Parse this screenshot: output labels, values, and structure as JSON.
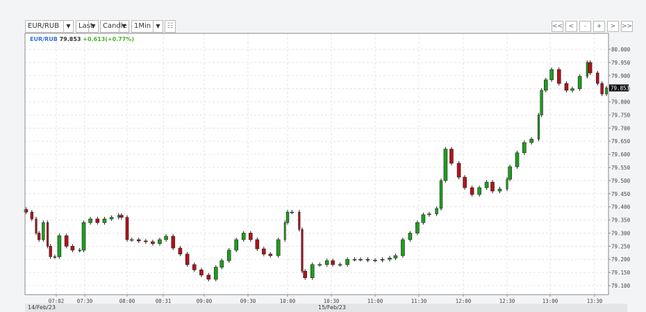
{
  "toolbar": {
    "symbol": "EUR/RUB",
    "price_type": "Last",
    "chart_type": "Candle",
    "interval": "1Min",
    "dropdown_icon": "triangle-down",
    "indicator_icon": "bar-chart-icon"
  },
  "nav": [
    "<<",
    "<",
    "-",
    "+",
    ">",
    ">>"
  ],
  "legend": {
    "symbol": "EUR/RUB",
    "price": "79.853",
    "change": "+0.613(+0.77%)",
    "symbol_color": "#3a6fd8",
    "change_color": "#4caf2a"
  },
  "dates": [
    "14/Feb/23",
    "15/Feb/23"
  ],
  "colors": {
    "up": "#1e9e1e",
    "down": "#b3121a"
  },
  "chart_data": {
    "type": "candlestick",
    "ylim": [
      79.08,
      80.06
    ],
    "y_ticks": [
      "80.000",
      "79.950",
      "79.900",
      "79.850",
      "79.800",
      "79.750",
      "79.700",
      "79.650",
      "79.600",
      "79.550",
      "79.500",
      "79.450",
      "79.400",
      "79.350",
      "79.300",
      "79.250",
      "79.200",
      "79.150",
      "79.100"
    ],
    "x_ticks": [
      "07:02",
      "07:30",
      "08:00",
      "08:31",
      "09:00",
      "09:30",
      "10:00",
      "10:30",
      "11:00",
      "11:30",
      "12:00",
      "12:30",
      "13:00",
      "13:30"
    ],
    "last_price": "79.853",
    "grid": true,
    "closes": [
      [
        "06:41",
        79.38
      ],
      [
        "06:45",
        79.354
      ],
      [
        "06:48",
        79.3
      ],
      [
        "06:50",
        79.275
      ],
      [
        "06:53",
        79.34
      ],
      [
        "06:56",
        79.25
      ],
      [
        "06:58",
        79.21
      ],
      [
        "07:01",
        79.21
      ],
      [
        "07:05",
        79.29
      ],
      [
        "07:12",
        79.25
      ],
      [
        "07:18",
        79.235
      ],
      [
        "07:25",
        79.235
      ],
      [
        "07:29",
        79.34
      ],
      [
        "07:34",
        79.354
      ],
      [
        "07:39",
        79.34
      ],
      [
        "07:44",
        79.354
      ],
      [
        "07:49",
        79.36
      ],
      [
        "07:54",
        79.368
      ],
      [
        "07:56",
        79.36
      ],
      [
        "08:00",
        79.275
      ],
      [
        "08:04",
        79.275
      ],
      [
        "08:10",
        79.27
      ],
      [
        "08:16",
        79.267
      ],
      [
        "08:22",
        79.26
      ],
      [
        "08:28",
        79.275
      ],
      [
        "08:33",
        79.288
      ],
      [
        "08:38",
        79.243
      ],
      [
        "08:43",
        79.22
      ],
      [
        "08:48",
        79.18
      ],
      [
        "08:53",
        79.16
      ],
      [
        "08:58",
        79.14
      ],
      [
        "09:03",
        79.124
      ],
      [
        "09:08",
        79.17
      ],
      [
        "09:12",
        79.195
      ],
      [
        "09:17",
        79.235
      ],
      [
        "09:22",
        79.275
      ],
      [
        "09:27",
        79.3
      ],
      [
        "09:32",
        79.275
      ],
      [
        "09:37",
        79.24
      ],
      [
        "09:42",
        79.22
      ],
      [
        "09:47",
        79.214
      ],
      [
        "09:53",
        79.275
      ],
      [
        "09:58",
        79.34
      ],
      [
        "10:00",
        79.38
      ],
      [
        "10:03",
        79.38
      ],
      [
        "10:08",
        79.314
      ],
      [
        "10:10",
        79.155
      ],
      [
        "10:12",
        79.13
      ],
      [
        "10:17",
        79.18
      ],
      [
        "10:22",
        79.18
      ],
      [
        "10:27",
        79.195
      ],
      [
        "10:31",
        79.18
      ],
      [
        "10:36",
        79.18
      ],
      [
        "10:41",
        79.2
      ],
      [
        "10:46",
        79.2
      ],
      [
        "10:50",
        79.2
      ],
      [
        "10:55",
        79.197
      ],
      [
        "11:00",
        79.197
      ],
      [
        "11:05",
        79.2
      ],
      [
        "11:10",
        79.205
      ],
      [
        "11:14",
        79.214
      ],
      [
        "11:19",
        79.275
      ],
      [
        "11:24",
        79.3
      ],
      [
        "11:29",
        79.34
      ],
      [
        "11:33",
        79.37
      ],
      [
        "11:37",
        79.373
      ],
      [
        "11:42",
        79.394
      ],
      [
        "11:45",
        79.5
      ],
      [
        "11:48",
        79.62
      ],
      [
        "11:52",
        79.566
      ],
      [
        "11:57",
        79.513
      ],
      [
        "12:01",
        79.473
      ],
      [
        "12:06",
        79.447
      ],
      [
        "12:11",
        79.473
      ],
      [
        "12:16",
        79.494
      ],
      [
        "12:20",
        79.46
      ],
      [
        "12:25",
        79.468
      ],
      [
        "12:30",
        79.505
      ],
      [
        "12:32",
        79.553
      ],
      [
        "12:37",
        79.606
      ],
      [
        "12:42",
        79.645
      ],
      [
        "12:47",
        79.658
      ],
      [
        "12:52",
        79.75
      ],
      [
        "12:54",
        79.844
      ],
      [
        "12:57",
        79.884
      ],
      [
        "13:01",
        79.923
      ],
      [
        "13:06",
        79.87
      ],
      [
        "13:11",
        79.844
      ],
      [
        "13:15",
        79.85
      ],
      [
        "13:20",
        79.897
      ],
      [
        "13:25",
        79.95
      ],
      [
        "13:27",
        79.91
      ],
      [
        "13:32",
        79.87
      ],
      [
        "13:35",
        79.83
      ],
      [
        "13:38",
        79.853
      ]
    ]
  }
}
